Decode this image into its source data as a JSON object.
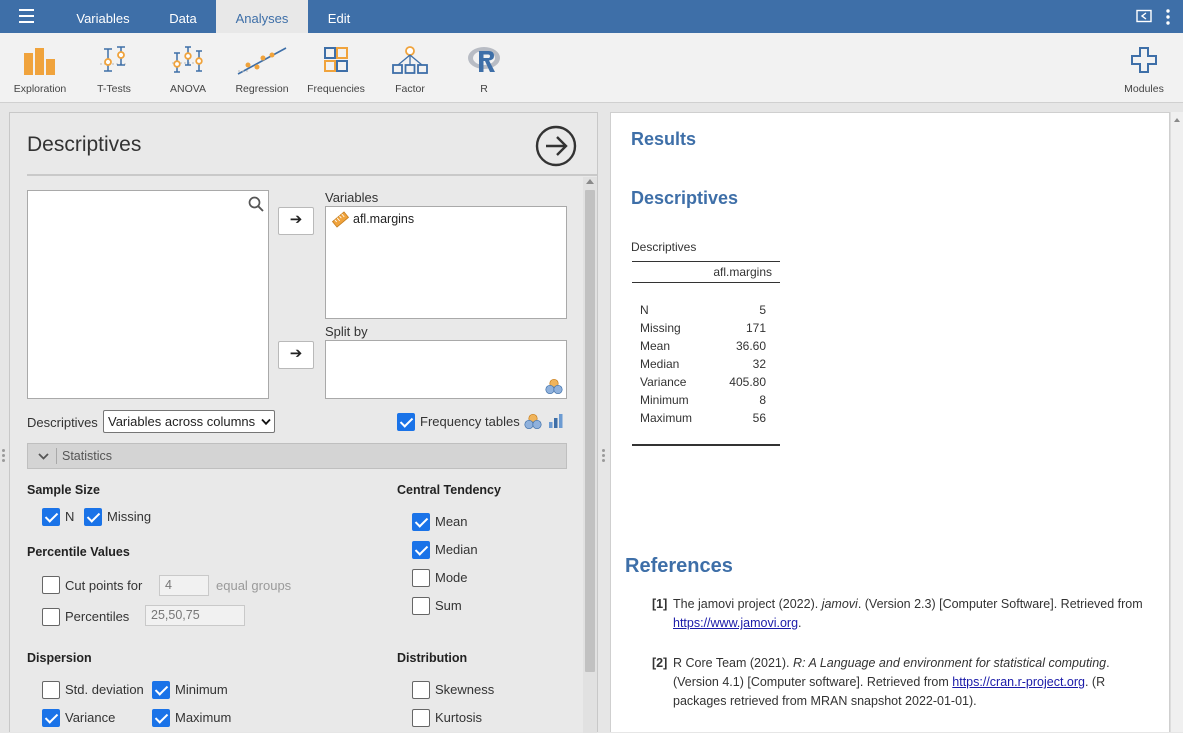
{
  "tabs": [
    {
      "label": "Variables"
    },
    {
      "label": "Data"
    },
    {
      "label": "Analyses"
    },
    {
      "label": "Edit"
    }
  ],
  "ribbon": {
    "buttons": [
      {
        "label": "Exploration"
      },
      {
        "label": "T-Tests"
      },
      {
        "label": "ANOVA"
      },
      {
        "label": "Regression"
      },
      {
        "label": "Frequencies"
      },
      {
        "label": "Factor"
      },
      {
        "label": "R"
      }
    ],
    "modules_label": "Modules"
  },
  "options": {
    "title": "Descriptives",
    "variables_label": "Variables",
    "variables": [
      "afl.margins"
    ],
    "splitby_label": "Split by",
    "descriptives_label": "Descriptives",
    "layout_select": "Variables across columns",
    "frequency_tables": {
      "label": "Frequency tables",
      "checked": true
    },
    "statistics_header": "Statistics",
    "sample_size": {
      "title": "Sample Size",
      "n": {
        "label": "N",
        "checked": true
      },
      "missing": {
        "label": "Missing",
        "checked": true
      }
    },
    "percentiles": {
      "title": "Percentile Values",
      "cut_points": {
        "label": "Cut points for",
        "value": "4",
        "suffix": "equal groups",
        "checked": false
      },
      "percentiles": {
        "label": "Percentiles",
        "value": "25,50,75",
        "checked": false
      }
    },
    "central": {
      "title": "Central Tendency",
      "mean": {
        "label": "Mean",
        "checked": true
      },
      "median": {
        "label": "Median",
        "checked": true
      },
      "mode": {
        "label": "Mode",
        "checked": false
      },
      "sum": {
        "label": "Sum",
        "checked": false
      }
    },
    "dispersion": {
      "title": "Dispersion",
      "std": {
        "label": "Std. deviation",
        "checked": false
      },
      "minimum": {
        "label": "Minimum",
        "checked": true
      },
      "variance": {
        "label": "Variance",
        "checked": true
      },
      "maximum": {
        "label": "Maximum",
        "checked": true
      }
    },
    "distribution": {
      "title": "Distribution",
      "skewness": {
        "label": "Skewness",
        "checked": false
      },
      "kurtosis": {
        "label": "Kurtosis",
        "checked": false
      }
    }
  },
  "results": {
    "title": "Results",
    "section_title": "Descriptives",
    "table": {
      "caption": "Descriptives",
      "column": "afl.margins",
      "rows": [
        {
          "label": "N",
          "value": "5"
        },
        {
          "label": "Missing",
          "value": "171"
        },
        {
          "label": "Mean",
          "value": "36.60"
        },
        {
          "label": "Median",
          "value": "32"
        },
        {
          "label": "Variance",
          "value": "405.80"
        },
        {
          "label": "Minimum",
          "value": "8"
        },
        {
          "label": "Maximum",
          "value": "56"
        }
      ]
    },
    "references": {
      "title": "References",
      "items": [
        {
          "num": "[1]",
          "pre": "The jamovi project (2022). ",
          "italic": "jamovi",
          "post": ". (Version 2.3) [Computer Software]. Retrieved from",
          "link": "https://www.jamovi.org",
          "tail": "."
        },
        {
          "num": "[2]",
          "pre": "R Core Team (2021). ",
          "italic": "R: A Language and environment for statistical computing",
          "post": ".",
          "line2": "(Version 4.1) [Computer software]. Retrieved from ",
          "link": "https://cran.r-project.org",
          "tail": ". (R",
          "line3": "packages retrieved from MRAN snapshot 2022-01-01)."
        }
      ]
    }
  },
  "colors": {
    "brand": "#3e6fa8",
    "checkbox": "#1a73e8",
    "ribbon_orange": "#f0a33c",
    "ribbon_blue": "#3e6fa8"
  }
}
